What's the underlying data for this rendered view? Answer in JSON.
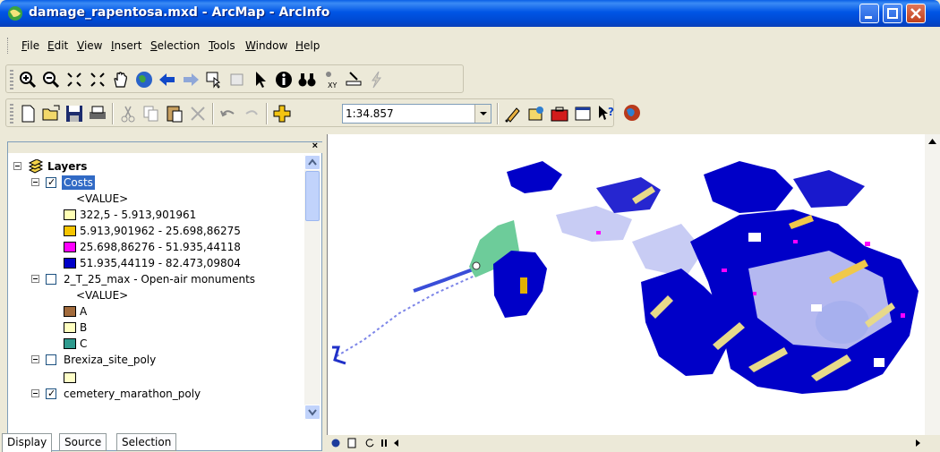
{
  "window": {
    "title": "damage_rapentosa.mxd - ArcMap - ArcInfo"
  },
  "menu": [
    "File",
    "Edit",
    "View",
    "Insert",
    "Selection",
    "Tools",
    "Window",
    "Help"
  ],
  "menu_underline": [
    "F",
    "E",
    "V",
    "I",
    "S",
    "T",
    "W",
    "H"
  ],
  "standard_toolbar": {
    "scale_value": "1:34.857"
  },
  "toc": {
    "root_label": "Layers",
    "value_header": "<VALUE>",
    "layers": [
      {
        "name": "Costs",
        "checked": true,
        "classes": [
          {
            "label": "322,5 - 5.913,901961",
            "color": "#ffffb4"
          },
          {
            "label": "5.913,901962 - 25.698,86275",
            "color": "#f5c400"
          },
          {
            "label": "25.698,86276 - 51.935,44118",
            "color": "#ff00ff"
          },
          {
            "label": "51.935,44119 - 82.473,09804",
            "color": "#0000c8"
          }
        ]
      },
      {
        "name": "2_T_25_max - Open-air monuments",
        "checked": false,
        "classes": [
          {
            "label": "A",
            "color": "#a26b3c"
          },
          {
            "label": "B",
            "color": "#ffffc0"
          },
          {
            "label": "C",
            "color": "#2f9a8e"
          }
        ]
      },
      {
        "name": "Brexiza_site_poly",
        "checked": false,
        "classes": [
          {
            "label": "",
            "color": "#ffffc8"
          }
        ]
      },
      {
        "name": "cemetery_marathon_poly",
        "checked": true,
        "classes": []
      }
    ],
    "tabs": [
      "Display",
      "Source",
      "Selection"
    ]
  },
  "colors": {
    "titlebar": "#0055e5",
    "selection": "#316ac5",
    "map_blue": "#0000c8",
    "map_light": "#c8ccf4",
    "map_green": "#6dcc9a"
  }
}
